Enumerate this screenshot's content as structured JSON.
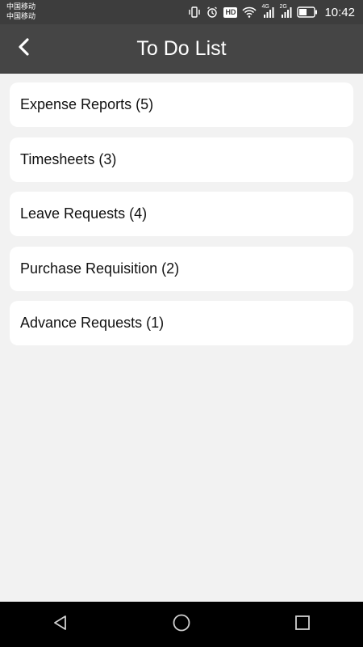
{
  "status_bar": {
    "carrier_1": "中国移动",
    "carrier_2": "中国移动",
    "time": "10:42",
    "icons": [
      "vibrate-icon",
      "alarm-icon",
      "hd-icon",
      "wifi-icon",
      "signal-4g-icon",
      "signal-2g-icon",
      "battery-icon"
    ],
    "hd_label": "HD",
    "net_1": "4G",
    "net_2": "2G"
  },
  "app_bar": {
    "title": "To Do List",
    "back_icon": "chevron-left-icon"
  },
  "todo_items": [
    {
      "label": "Expense Reports (5)"
    },
    {
      "label": "Timesheets (3)"
    },
    {
      "label": "Leave Requests (4)"
    },
    {
      "label": "Purchase Requisition (2)"
    },
    {
      "label": "Advance Requests (1)"
    }
  ],
  "nav_bar": {
    "icons": [
      "back-triangle-icon",
      "home-circle-icon",
      "recents-square-icon"
    ]
  },
  "colors": {
    "status_bar_bg": "#3d3d3d",
    "app_bar_bg": "#454545",
    "page_bg": "#f2f2f2",
    "card_bg": "#ffffff",
    "nav_bar_bg": "#000000"
  }
}
